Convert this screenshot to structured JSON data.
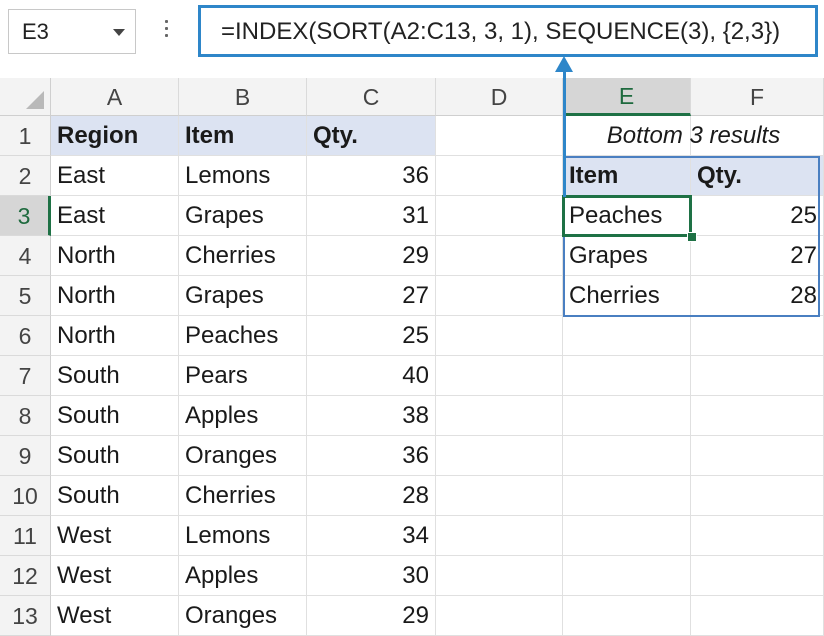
{
  "name_box": {
    "value": "E3"
  },
  "formula_bar": {
    "value": "=INDEX(SORT(A2:C13, 3, 1), SEQUENCE(3), {2,3})"
  },
  "columns": [
    "A",
    "B",
    "C",
    "D",
    "E",
    "F"
  ],
  "rows": [
    "1",
    "2",
    "3",
    "4",
    "5",
    "6",
    "7",
    "8",
    "9",
    "10",
    "11",
    "12",
    "13"
  ],
  "table": {
    "headers": [
      "Region",
      "Item",
      "Qty."
    ],
    "data": [
      [
        "East",
        "Lemons",
        "36"
      ],
      [
        "East",
        "Grapes",
        "31"
      ],
      [
        "North",
        "Cherries",
        "29"
      ],
      [
        "North",
        "Grapes",
        "27"
      ],
      [
        "North",
        "Peaches",
        "25"
      ],
      [
        "South",
        "Pears",
        "40"
      ],
      [
        "South",
        "Apples",
        "38"
      ],
      [
        "South",
        "Oranges",
        "36"
      ],
      [
        "South",
        "Cherries",
        "28"
      ],
      [
        "West",
        "Lemons",
        "34"
      ],
      [
        "West",
        "Apples",
        "30"
      ],
      [
        "West",
        "Oranges",
        "29"
      ]
    ]
  },
  "results": {
    "title": "Bottom 3 results",
    "headers": [
      "Item",
      "Qty."
    ],
    "data": [
      [
        "Peaches",
        "25"
      ],
      [
        "Grapes",
        "27"
      ],
      [
        "Cherries",
        "28"
      ]
    ]
  },
  "colors": {
    "formula_highlight": "#2e86c9",
    "header_fill": "#dce3f2",
    "selection_green": "#1e7145",
    "result_border": "#4a7fc1"
  },
  "icons": [
    "dropdown-arrow-icon",
    "more-options-icon",
    "select-all-triangle-icon",
    "callout-arrow-icon"
  ]
}
